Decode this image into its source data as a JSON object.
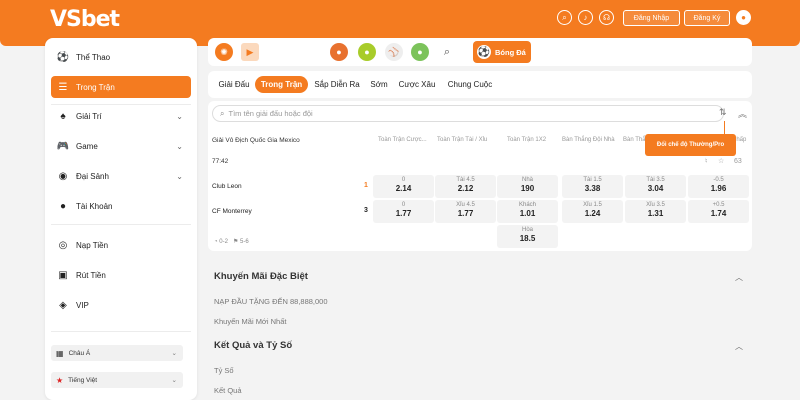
{
  "brand": {
    "logo": "VSbet",
    "accent": "#f47b20"
  },
  "header": {
    "icons": [
      "search-icon",
      "bell-icon",
      "headset-icon"
    ],
    "login_label": "Đăng Nhập",
    "register_label": "Đăng Ký",
    "user_icon": "user-icon"
  },
  "sidebar": {
    "items": [
      {
        "label": "Thể Thao",
        "icon": "⚽"
      },
      {
        "label": "Trong Trận",
        "icon": "☰"
      },
      {
        "label": "Giải Trí",
        "icon": "♠"
      },
      {
        "label": "Game",
        "icon": "🎮"
      },
      {
        "label": "Đại Sảnh",
        "icon": "◉"
      },
      {
        "label": "Tài Khoản",
        "icon": "●"
      },
      {
        "label": "Nạp Tiền",
        "icon": "◎"
      },
      {
        "label": "Rút Tiền",
        "icon": "▣"
      },
      {
        "label": "VIP",
        "icon": "◈"
      }
    ],
    "region_select": "Châu Á",
    "language_select": "Tiếng Việt"
  },
  "sports": {
    "active_label": "Bóng Đá"
  },
  "tabs": [
    "Giải Đấu",
    "Trong Trận",
    "Sắp Diễn Ra",
    "Sớm",
    "Cược Xâu",
    "Chung Cuộc"
  ],
  "search": {
    "placeholder": "Tìm tên giải đấu hoặc đội"
  },
  "match": {
    "league": "Giải Vô Địch Quốc Gia Mexico",
    "columns": [
      "Toàn Trận Cược...",
      "Toàn Trận Tài / Xỉu",
      "Toàn Trận 1X2",
      "Bàn Thắng Đội Nhà",
      "Bàn Thắ",
      "Chấp"
    ],
    "time": "77:42",
    "count": "63",
    "home_team": "Club Leon",
    "away_team": "CF Monterrey",
    "home_score": "1",
    "away_score": "3",
    "tooltip": "Đổi chế độ Thường/Pro",
    "footer_corners": "0-2",
    "footer_extra": "5-6",
    "odds": {
      "c1": [
        {
          "lab": "0",
          "val": "2.14"
        },
        {
          "lab": "0",
          "val": "1.77"
        }
      ],
      "c2": [
        {
          "lab": "Tài 4.5",
          "val": "2.12"
        },
        {
          "lab": "Xỉu 4.5",
          "val": "1.77"
        }
      ],
      "c3": [
        {
          "lab": "Nhà",
          "val": "190"
        },
        {
          "lab": "Khách",
          "val": "1.01"
        },
        {
          "lab": "Hòa",
          "val": "18.5"
        }
      ],
      "c4": [
        {
          "lab": "Tài 1.5",
          "val": "3.38"
        },
        {
          "lab": "Xỉu 1.5",
          "val": "1.24"
        }
      ],
      "c5": [
        {
          "lab": "Tài 3.5",
          "val": "3.04"
        },
        {
          "lab": "Xỉu 3.5",
          "val": "1.31"
        }
      ],
      "c6": [
        {
          "lab": "-0.5",
          "val": "1.96"
        },
        {
          "lab": "+0.5",
          "val": "1.74"
        }
      ]
    }
  },
  "promo": {
    "title": "Khuyến Mãi Đặc Biệt",
    "items": [
      "NẠP ĐẦU TẶNG ĐẾN 88,888,000",
      "Khuyến Mãi Mới Nhất"
    ]
  },
  "results": {
    "title": "Kết Quả và Tỷ Số",
    "items": [
      "Tỷ Số",
      "Kết Quả"
    ]
  }
}
